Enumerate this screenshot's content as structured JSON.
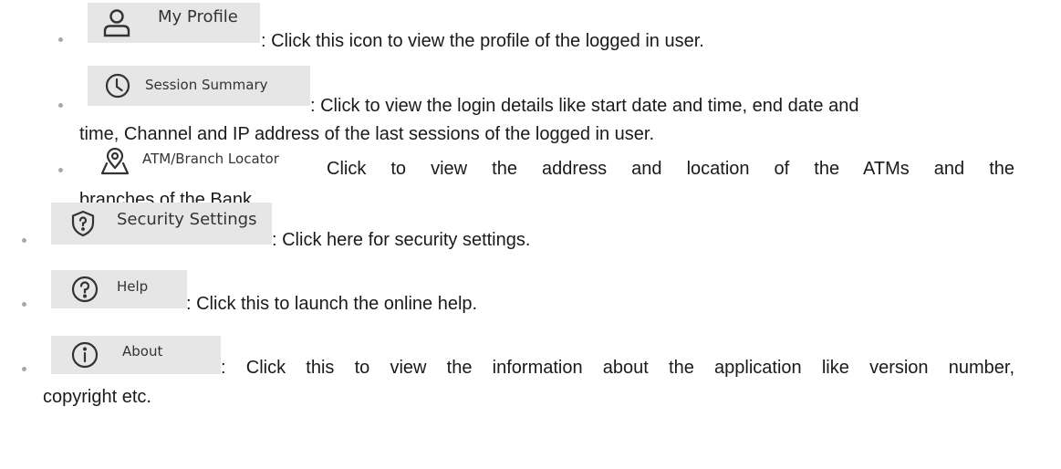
{
  "items": [
    {
      "button_label": "My Profile",
      "icon": "user-icon",
      "description": ": Click this icon to view the profile of the logged in user.",
      "continuation": ""
    },
    {
      "button_label": "Session Summary",
      "icon": "clock-icon",
      "description": ": Click to view the login details like start date and time, end date and",
      "continuation": "time, Channel and IP address of the last sessions of the logged in user."
    },
    {
      "button_label": "ATM/Branch Locator",
      "icon": "map-pin-icon",
      "description": "Click to view the address and location of the ATMs and the",
      "continuation": "branches of the Bank."
    },
    {
      "button_label": "Security Settings",
      "icon": "shield-question-icon",
      "description": ": Click here for security settings.",
      "continuation": ""
    },
    {
      "button_label": "Help",
      "icon": "help-icon",
      "description": ": Click this to launch the online help.",
      "continuation": ""
    },
    {
      "button_label": "About",
      "icon": "info-icon",
      "description": ": Click this to view the information about the application like version number,",
      "continuation": "copyright etc."
    }
  ],
  "colors": {
    "button_bg": "#e6e6e6",
    "button_text": "#333333",
    "bullet": "#a8a8a8",
    "text": "#1a1a1a"
  }
}
